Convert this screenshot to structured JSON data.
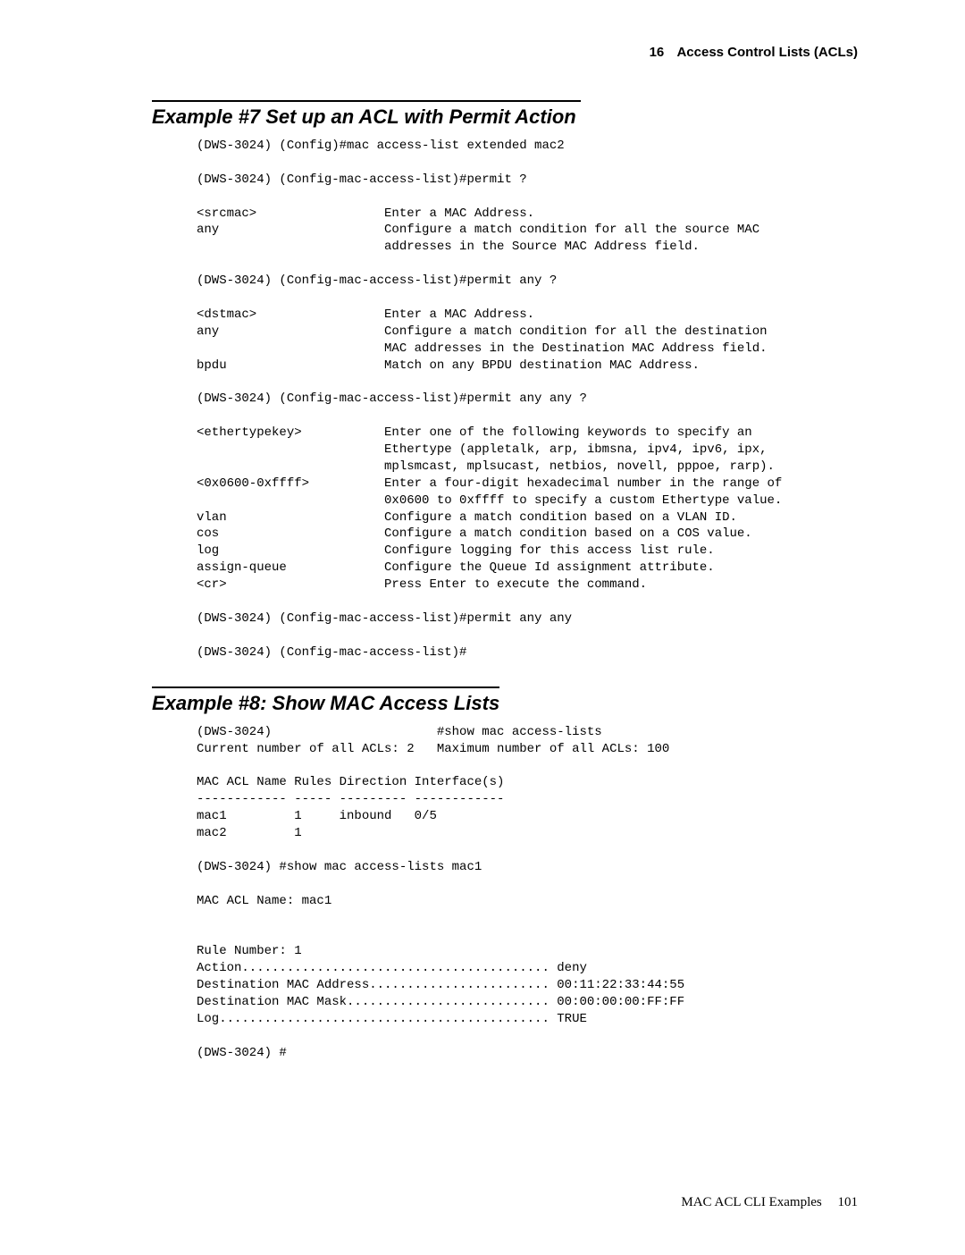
{
  "header": {
    "chapter_number": "16",
    "chapter_title": "Access Control Lists (ACLs)"
  },
  "section7": {
    "title": "Example #7 Set up an ACL with Permit Action",
    "cli": "(DWS-3024) (Config)#mac access-list extended mac2\n\n(DWS-3024) (Config-mac-access-list)#permit ?\n\n<srcmac>                 Enter a MAC Address.\nany                      Configure a match condition for all the source MAC\n                         addresses in the Source MAC Address field.\n\n(DWS-3024) (Config-mac-access-list)#permit any ?\n\n<dstmac>                 Enter a MAC Address.\nany                      Configure a match condition for all the destination\n                         MAC addresses in the Destination MAC Address field.\nbpdu                     Match on any BPDU destination MAC Address.\n\n(DWS-3024) (Config-mac-access-list)#permit any any ?\n\n<ethertypekey>           Enter one of the following keywords to specify an\n                         Ethertype (appletalk, arp, ibmsna, ipv4, ipv6, ipx,\n                         mplsmcast, mplsucast, netbios, novell, pppoe, rarp).\n<0x0600-0xffff>          Enter a four-digit hexadecimal number in the range of\n                         0x0600 to 0xffff to specify a custom Ethertype value.\nvlan                     Configure a match condition based on a VLAN ID.\ncos                      Configure a match condition based on a COS value.\nlog                      Configure logging for this access list rule.\nassign-queue             Configure the Queue Id assignment attribute.\n<cr>                     Press Enter to execute the command.\n\n(DWS-3024) (Config-mac-access-list)#permit any any\n\n(DWS-3024) (Config-mac-access-list)#"
  },
  "section8": {
    "title": "Example #8: Show MAC Access Lists",
    "cli": "(DWS-3024)                      #show mac access-lists\nCurrent number of all ACLs: 2   Maximum number of all ACLs: 100\n\nMAC ACL Name Rules Direction Interface(s)\n------------ ----- --------- ------------\nmac1         1     inbound   0/5\nmac2         1\n\n(DWS-3024) #show mac access-lists mac1\n\nMAC ACL Name: mac1\n\n\nRule Number: 1\nAction......................................... deny\nDestination MAC Address........................ 00:11:22:33:44:55\nDestination MAC Mask........................... 00:00:00:00:FF:FF\nLog............................................ TRUE\n\n(DWS-3024) #"
  },
  "footer": {
    "label": "MAC ACL CLI Examples",
    "page": "101"
  }
}
